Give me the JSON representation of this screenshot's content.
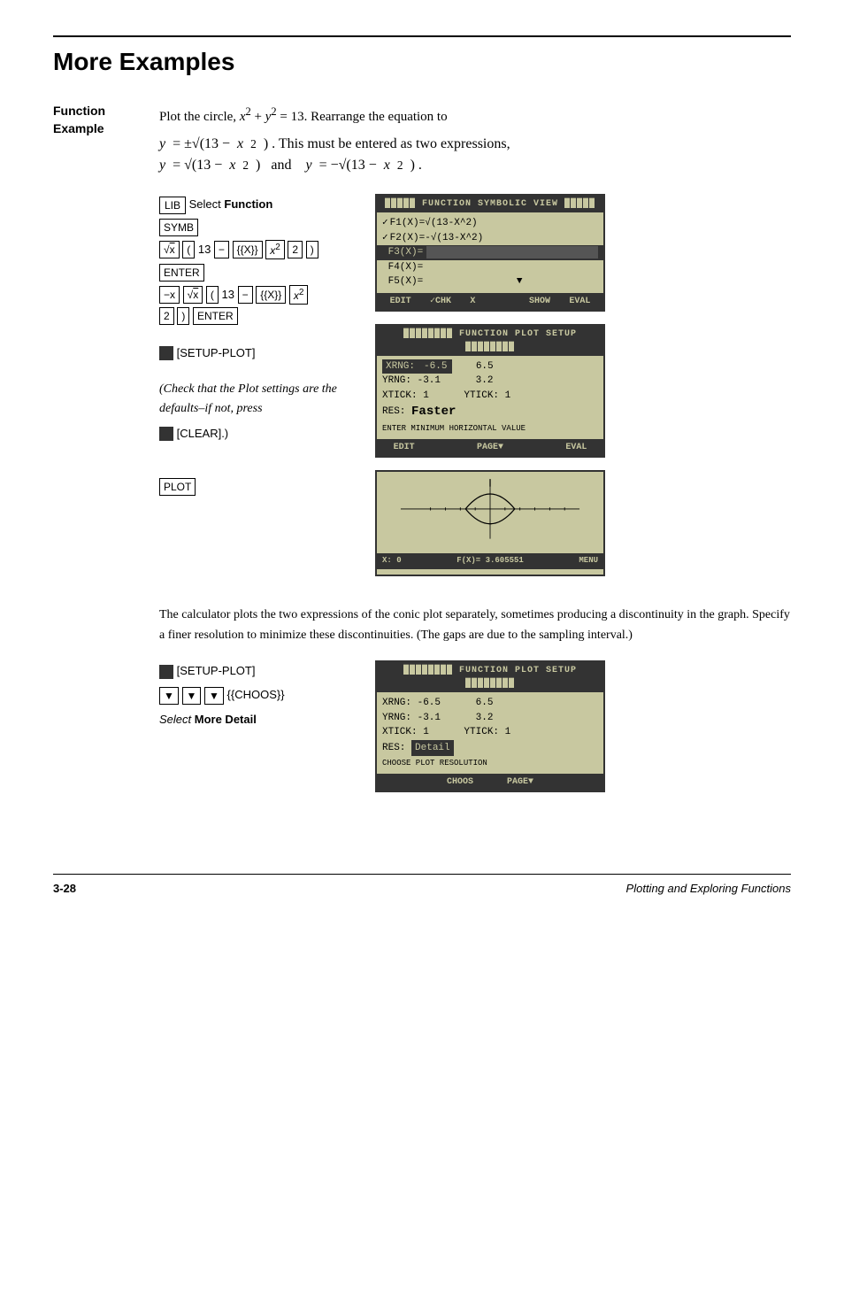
{
  "page": {
    "title": "More Examples",
    "footer_left": "3-28",
    "footer_right": "Plotting and Exploring Functions"
  },
  "function_example": {
    "label_line1": "Function",
    "label_line2": "Example",
    "intro": "Plot the circle, x² + y² = 13. Rearrange the equation to",
    "eq1": "y = ±√(13 − x²)",
    "eq1_note": ". This must be entered as two expressions,",
    "eq2": "y = √(13 − x²)",
    "eq2_and": "and",
    "eq3": "y = −√(13 − x²)",
    "eq3_end": "."
  },
  "instructions": {
    "lib_select": "Select",
    "lib_select_bold": "Function",
    "symb_key": "SYMB",
    "enter_key": "ENTER",
    "plot_key": "PLOT",
    "setup_plot_label": "[SETUP-PLOT]",
    "setup_plot_note": "(Check that the Plot settings are the defaults–if not, press",
    "clear_key": "CLEAR",
    "setup_plot_note2": "[SETUP-PLOT]",
    "down_keys": "▼▼▼",
    "choos_label": "{{CHOOS}}",
    "select_more_detail": "Select More Detail",
    "select_italic": "Select"
  },
  "screen1": {
    "header": "FUNCTION SYMBOLIC VIEW",
    "f1": "✓F1(X)=√(13-X^2)",
    "f2": "✓F2(X)=-√(13-X^2)",
    "f3_highlighted": "F3(X)=",
    "f4": "F4(X)=",
    "f5": "F5(X)=",
    "footer_btns": [
      "EDIT",
      "✓CHK",
      "X",
      "",
      "SHOW",
      "EVAL"
    ]
  },
  "screen2": {
    "header": "FUNCTION PLOT SETUP",
    "xrng_label": "XRNG:",
    "xrng_val1": "-6.5",
    "xrng_val2": "6.5",
    "yrng_label": "YRNG:",
    "yrng_val1": "-3.1",
    "yrng_val2": "3.2",
    "xtick_label": "XTICK:",
    "xtick_val": "1",
    "ytick_label": "YTICK:",
    "ytick_val": "1",
    "res_label": "RES:",
    "res_val": "Faster",
    "status_line": "ENTER MINIMUM HORIZONTAL VALUE",
    "footer_btns": [
      "EDIT",
      "",
      "PAGE▼",
      "",
      "EVAL"
    ]
  },
  "screen3": {
    "plot_footer_x": "X: 0",
    "plot_footer_f": "F(X)= 3.605551",
    "plot_footer_menu": "MENU"
  },
  "body_text": "The calculator plots the two expressions of the conic plot separately, sometimes producing a discontinuity in the graph. Specify a finer resolution to minimize these discontinuities. (The gaps are due to the sampling interval.)",
  "screen4": {
    "header": "FUNCTION PLOT SETUP",
    "xrng_label": "XRNG:",
    "xrng_val1": "-6.5",
    "xrng_val2": "6.5",
    "yrng_label": "YRNG:",
    "yrng_val1": "-3.1",
    "yrng_val2": "3.2",
    "xtick_label": "XTICK:",
    "xtick_val": "1",
    "ytick_label": "YTICK:",
    "ytick_val": "1",
    "res_label": "RES:",
    "res_val_highlighted": "Detail",
    "status_line": "CHOOSE PLOT RESOLUTION",
    "footer_btns": [
      "CHOOS",
      "PAGE▼",
      ""
    ]
  }
}
